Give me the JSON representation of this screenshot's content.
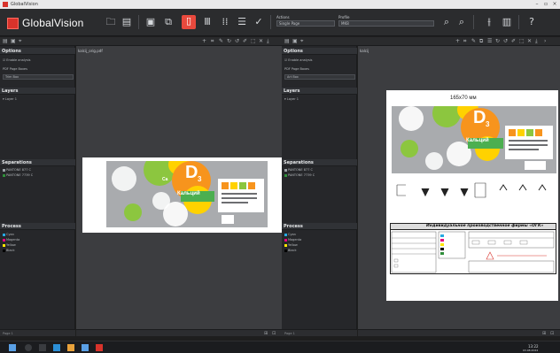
{
  "window": {
    "title": "GlobalVision"
  },
  "toolbar": {
    "logo_text": "GlobalVision",
    "actions_label": "Actions",
    "actions_value": "Single Page",
    "profile_label": "Profile",
    "profile_value": "MKB"
  },
  "left_pane": {
    "file_name": "kalcij_orig.pdf",
    "options_header": "Options",
    "enable_analysis": "Enable analysis",
    "pdf_page_boxes_label": "PDF Page Boxes",
    "pdf_page_boxes_value": "Trim Box",
    "layers_header": "Layers",
    "layer_item": "Layer 1",
    "separations_header": "Separations",
    "separations": [
      "PANTONE 877 C",
      "PANTONE 7739 C"
    ],
    "process_header": "Process",
    "process": [
      {
        "name": "Cyan",
        "color": "#27a9e1"
      },
      {
        "name": "Magenta",
        "color": "#e5007e"
      },
      {
        "name": "Yellow",
        "color": "#ffe600"
      },
      {
        "name": "Black",
        "color": "#000000"
      }
    ],
    "page_indicator": "Page 1"
  },
  "right_pane": {
    "file_name": "kalcij",
    "options_header": "Options",
    "enable_analysis": "Enable analysis",
    "pdf_page_boxes_label": "PDF Page Boxes",
    "pdf_page_boxes_value": "Art Box",
    "layers_header": "Layers",
    "layer_item": "Layer 1",
    "separations_header": "Separations",
    "separations": [
      "PANTONE 877 C",
      "PANTONE 7739 C"
    ],
    "process_header": "Process",
    "process": [
      {
        "name": "Cyan",
        "color": "#27a9e1"
      },
      {
        "name": "Magenta",
        "color": "#e5007e"
      },
      {
        "name": "Yellow",
        "color": "#ffe600"
      },
      {
        "name": "Black",
        "color": "#000000"
      }
    ],
    "page_indicator": "Page 1",
    "dimension_text": "165x70 мм",
    "company_banner": "Индивидуальное производственное фирмы «ОГК»"
  },
  "artwork": {
    "product_letter": "D",
    "product_sub": "3",
    "product_name": "Кальций",
    "ca_label": "Ca"
  },
  "colors": {
    "accent": "#e8493d",
    "panel_bg": "#26272a",
    "canvas_bg": "#3c3d40"
  },
  "taskbar": {
    "time": "13:22",
    "date": "03.08.2024"
  }
}
